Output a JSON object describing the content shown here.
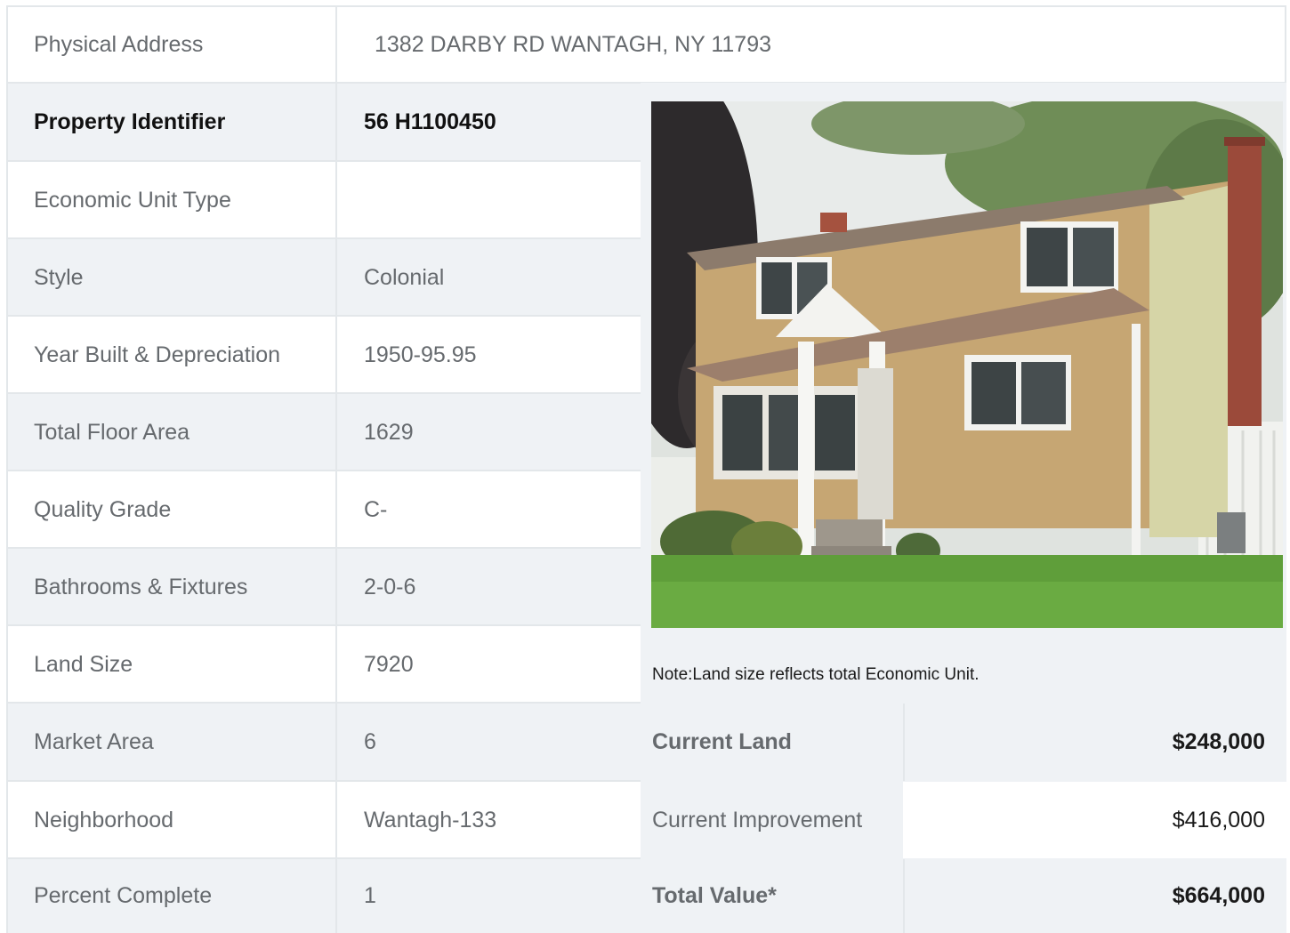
{
  "physical_address": {
    "label": "Physical Address",
    "value": "1382  DARBY RD  WANTAGH, NY  11793"
  },
  "details": [
    {
      "label": "Property Identifier",
      "value": "56  H1100450"
    },
    {
      "label": "Economic Unit Type",
      "value": ""
    },
    {
      "label": "Style",
      "value": "Colonial"
    },
    {
      "label": "Year Built & Depreciation",
      "value": "1950-95.95"
    },
    {
      "label": "Total Floor Area",
      "value": "1629"
    },
    {
      "label": "Quality Grade",
      "value": "C-"
    },
    {
      "label": "Bathrooms & Fixtures",
      "value": "2-0-6"
    },
    {
      "label": "Land Size",
      "value": "7920"
    },
    {
      "label": "Market Area",
      "value": "6"
    },
    {
      "label": "Neighborhood",
      "value": "Wantagh-133"
    },
    {
      "label": "Percent Complete",
      "value": "1"
    }
  ],
  "note": "Note:Land size reflects total Economic Unit.",
  "valuation": [
    {
      "label": "Current Land",
      "value": "$248,000"
    },
    {
      "label": "Current Improvement",
      "value": "$416,000"
    },
    {
      "label": "Total Value*",
      "value": "$664,000"
    }
  ]
}
